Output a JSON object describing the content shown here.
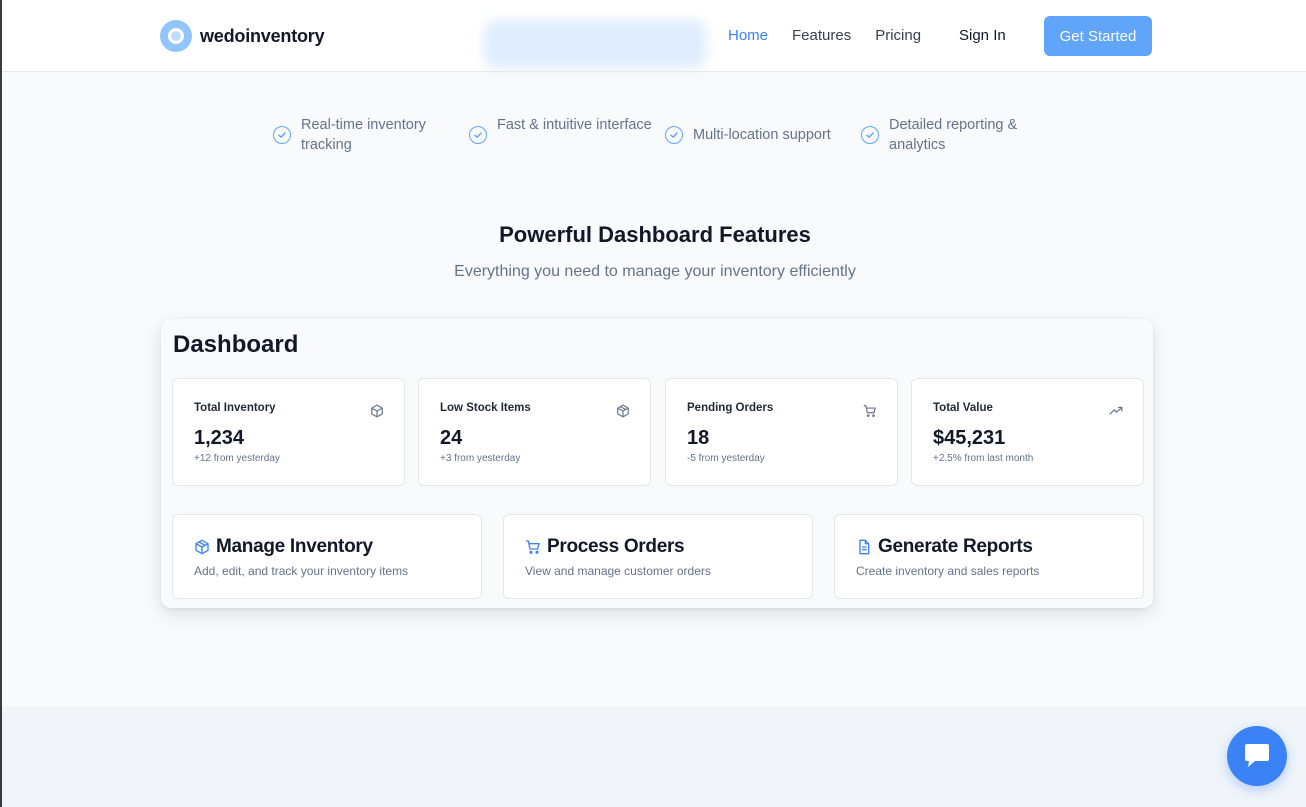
{
  "brand": {
    "name": "wedoinventory"
  },
  "nav": [
    {
      "label": "Home",
      "active": true
    },
    {
      "label": "Features",
      "active": false
    },
    {
      "label": "Pricing",
      "active": false
    }
  ],
  "auth": {
    "signin_label": "Sign In",
    "cta_label": "Get Started"
  },
  "bullets": [
    "Real-time inventory tracking",
    "Fast & intuitive interface",
    "Multi-location support",
    "Detailed reporting & analytics"
  ],
  "section": {
    "title": "Powerful Dashboard Features",
    "subtitle": "Everything you need to manage your inventory efficiently"
  },
  "dashboard": {
    "title": "Dashboard",
    "stats": [
      {
        "label": "Total Inventory",
        "value": "1,234",
        "delta": "+12 from yesterday",
        "icon": "cube-icon"
      },
      {
        "label": "Low Stock Items",
        "value": "24",
        "delta": "+3 from yesterday",
        "icon": "boxes-icon"
      },
      {
        "label": "Pending Orders",
        "value": "18",
        "delta": "-5 from yesterday",
        "icon": "cart-icon"
      },
      {
        "label": "Total Value",
        "value": "$45,231",
        "delta": "+2.5% from last month",
        "icon": "trending-up-icon"
      }
    ],
    "actions": [
      {
        "title": "Manage Inventory",
        "desc": "Add, edit, and track your inventory items",
        "icon": "boxes-icon"
      },
      {
        "title": "Process Orders",
        "desc": "View and manage customer orders",
        "icon": "cart-icon"
      },
      {
        "title": "Generate Reports",
        "desc": "Create inventory and sales reports",
        "icon": "document-icon"
      }
    ]
  },
  "colors": {
    "accent": "#3b82f6",
    "cta": "#60a5fa",
    "muted": "#64748b"
  },
  "chat": {
    "icon": "chat-bubble-icon"
  }
}
